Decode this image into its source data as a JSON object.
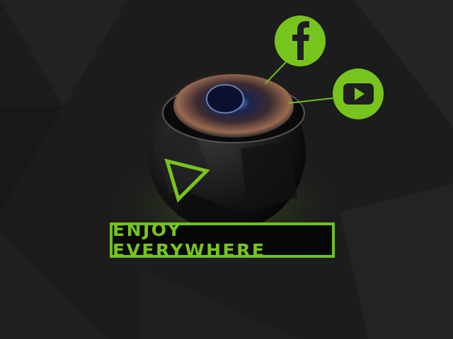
{
  "tagline": "ENJOY EVERYWHERE",
  "social_icons": [
    "facebook-icon",
    "youtube-icon"
  ],
  "colors": {
    "accent": "#78c41f",
    "background": "#1c1c1c"
  }
}
